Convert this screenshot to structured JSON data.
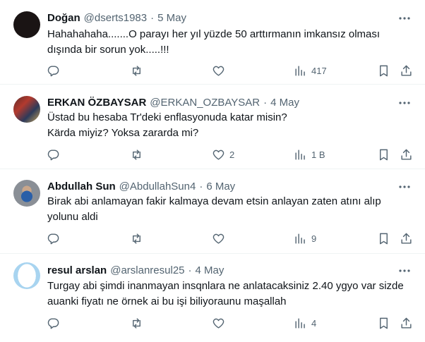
{
  "tweets": [
    {
      "name": "Doğan",
      "handle": "@dserts1983",
      "sep": "·",
      "date": "5 May",
      "lines": [
        "Hahahahaha.......O parayı her yıl yüzde 50 arttırmanın imkansız olması",
        "dışında bir sorun yok.....!!!"
      ],
      "replies": "",
      "retweets": "",
      "likes": "",
      "views": "417"
    },
    {
      "name": "ERKAN ÖZBAYSAR",
      "handle": "@ERKAN_OZBAYSAR",
      "sep": "·",
      "date": "4 May",
      "lines": [
        "Üstad bu hesaba Tr'deki enflasyonuda katar misin?",
        "Kärda miyiz? Yoksa zararda mi?"
      ],
      "replies": "",
      "retweets": "",
      "likes": "2",
      "views": "1 B"
    },
    {
      "name": "Abdullah Sun",
      "handle": "@AbdullahSun4",
      "sep": "·",
      "date": "6 May",
      "lines": [
        "Birak abi anlamayan fakir kalmaya devam etsin anlayan zaten atını alıp",
        "yolunu aldi"
      ],
      "replies": "",
      "retweets": "",
      "likes": "",
      "views": "9"
    },
    {
      "name": "resul arslan",
      "handle": "@arslanresul25",
      "sep": "·",
      "date": "4 May",
      "lines": [
        "Turgay abi şimdi inanmayan insqnlara ne anlatacaksiniz 2.40 ygyo var sizde",
        "auanki fiyatı ne örnek ai bu işi biliyoraunu maşallah"
      ],
      "replies": "",
      "retweets": "",
      "likes": "",
      "views": "4"
    }
  ],
  "icons": {
    "more": "more-horizontal-icon",
    "reply": "reply-icon",
    "retweet": "retweet-icon",
    "like": "heart-icon",
    "views": "views-bar-chart-icon",
    "bookmark": "bookmark-icon",
    "share": "share-icon"
  },
  "colors": {
    "text": "#0f1419",
    "secondary": "#536471",
    "divider": "#eff3f4"
  }
}
